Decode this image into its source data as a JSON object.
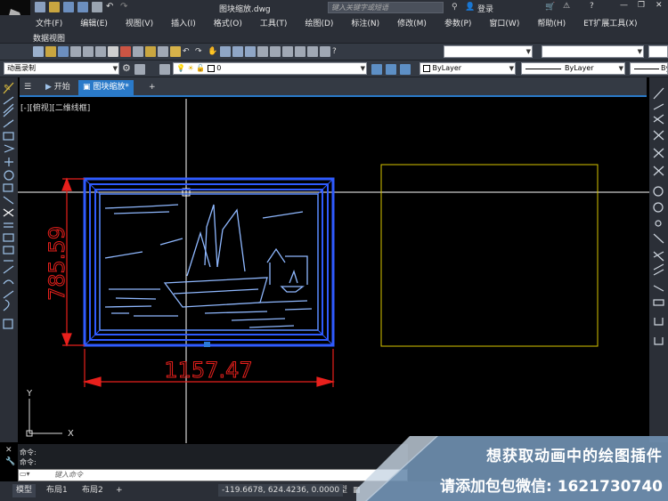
{
  "title": {
    "filename": "图块缩放.dwg",
    "search_placeholder": "键入关键字或短语",
    "login": "登录"
  },
  "menu": [
    "文件(F)",
    "编辑(E)",
    "视图(V)",
    "插入(I)",
    "格式(O)",
    "工具(T)",
    "绘图(D)",
    "标注(N)",
    "修改(M)",
    "参数(P)",
    "窗口(W)",
    "帮助(H)",
    "ET扩展工具(X)"
  ],
  "submenu": "数据视图",
  "toolbar": {
    "workspace": "动画录制",
    "layer": "0",
    "color": "ByLayer",
    "linetype": "ByLayer",
    "lineweight": "By"
  },
  "tabs": [
    {
      "label": "开始"
    },
    {
      "label": "图块缩放*"
    },
    {
      "label": "+"
    }
  ],
  "viewport_label": "[-][俯视][二维线框]",
  "dimensions": {
    "vertical": "785.59",
    "horizontal": "1157.47"
  },
  "command": {
    "line1": "命令:",
    "line2": "命令:",
    "placeholder": "键入命令"
  },
  "status": {
    "tabs": [
      "模型",
      "布局1",
      "布局2",
      "+"
    ],
    "coords": "-119.6678, 624.4236, 0.0000",
    "mode": "模型"
  },
  "overlay": {
    "line1": "想获取动画中的绘图插件",
    "line2": "请添加包包微信: 1621730740"
  },
  "colors": {
    "accent": "#2a7ac9",
    "frame": "#2f5bff",
    "dimension": "#e8201c",
    "rect": "#d6c400"
  },
  "icons": [
    "new-icon",
    "open-icon",
    "save-icon",
    "saveas-icon",
    "print-icon",
    "undo-icon",
    "redo-icon",
    "share-icon",
    "user-icon",
    "cart-icon",
    "help-icon",
    "pan-icon",
    "zoom-icon",
    "layer-icon",
    "bulb-icon",
    "sun-icon",
    "lock-icon",
    "line-icon",
    "polyline-icon",
    "circle-icon",
    "arc-icon",
    "rectangle-icon",
    "hatch-icon",
    "move-icon",
    "copy-icon",
    "rotate-icon",
    "scale-icon",
    "trim-icon",
    "erase-icon",
    "explode-icon",
    "brush-icon",
    "settings-icon"
  ]
}
